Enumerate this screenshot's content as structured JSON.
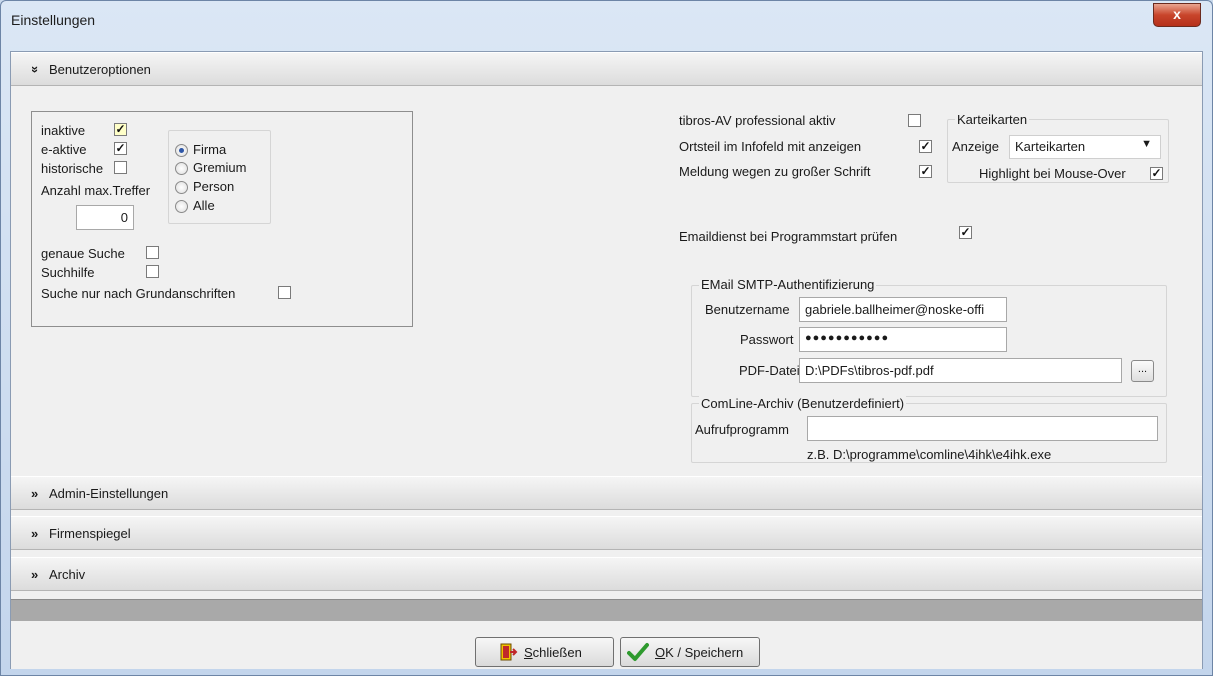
{
  "window": {
    "title": "Einstellungen",
    "close": "x"
  },
  "sections": {
    "benutzeroptionen": {
      "chevron": "»",
      "label": "Benutzeroptionen"
    },
    "admin": {
      "chevron": "»",
      "label": "Admin-Einstellungen"
    },
    "firmenspiegel": {
      "chevron": "»",
      "label": "Firmenspiegel"
    },
    "archiv": {
      "chevron": "»",
      "label": "Archiv"
    }
  },
  "search": {
    "inaktive": {
      "label": "inaktive",
      "checked": "✓"
    },
    "e_aktive": {
      "label": "e-aktive",
      "checked": "✓"
    },
    "historische": {
      "label": "historische",
      "checked": ""
    },
    "max_treffer_label": "Anzahl max.Treffer",
    "max_treffer_value": "0",
    "genaue_suche": {
      "label": "genaue Suche",
      "checked": ""
    },
    "suchhilfe": {
      "label": "Suchhilfe",
      "checked": ""
    },
    "grundanschriften": {
      "label": "Suche nur nach Grundanschriften",
      "checked": ""
    },
    "radios": [
      "Firma",
      "Gremium",
      "Person",
      "Alle"
    ],
    "radio_selected": "Firma"
  },
  "options": {
    "tibros_av": {
      "label": "tibros-AV professional aktiv",
      "checked": ""
    },
    "ortsteil": {
      "label": "Ortsteil im Infofeld mit anzeigen",
      "checked": "✓"
    },
    "meldung": {
      "label": "Meldung wegen zu großer Schrift",
      "checked": "✓"
    },
    "emaildienst": {
      "label": "Emaildienst bei Programmstart prüfen",
      "checked": "✓"
    }
  },
  "karteikarten": {
    "title": "Karteikarten",
    "anzeige_label": "Anzeige",
    "anzeige_value": "Karteikarten",
    "highlight_label": "Highlight bei Mouse-Over",
    "highlight_checked": "✓"
  },
  "smtp": {
    "title": "EMail SMTP-Authentifizierung",
    "benutzername_label": "Benutzername",
    "benutzername_value": "gabriele.ballheimer@noske-offi",
    "passwort_label": "Passwort",
    "passwort_value": "●●●●●●●●●●●",
    "pdf_label": "PDF-Datei",
    "pdf_value": "D:\\PDFs\\tibros-pdf.pdf",
    "browse_label": "..."
  },
  "comline": {
    "title": "ComLine-Archiv (Benutzerdefiniert)",
    "aufruf_label": "Aufrufprogramm",
    "aufruf_value": "",
    "hint": "z.B. D:\\programme\\comline\\4ihk\\e4ihk.exe"
  },
  "buttons": {
    "schliessen_mnemonic": "S",
    "schliessen_rest": "chließen",
    "ok_mnemonic": "O",
    "ok_rest": "K / Speichern"
  },
  "colors": {
    "close_red": "#c8452b",
    "ok_check_green": "#2e9a2e",
    "exit_icon_red": "#c0282a",
    "exit_icon_yellow": "#f2c200",
    "radio_dot": "#2d56a7"
  },
  "icons": {
    "close": "close-icon",
    "exit": "exit-door-icon",
    "ok": "checkmark-icon"
  }
}
